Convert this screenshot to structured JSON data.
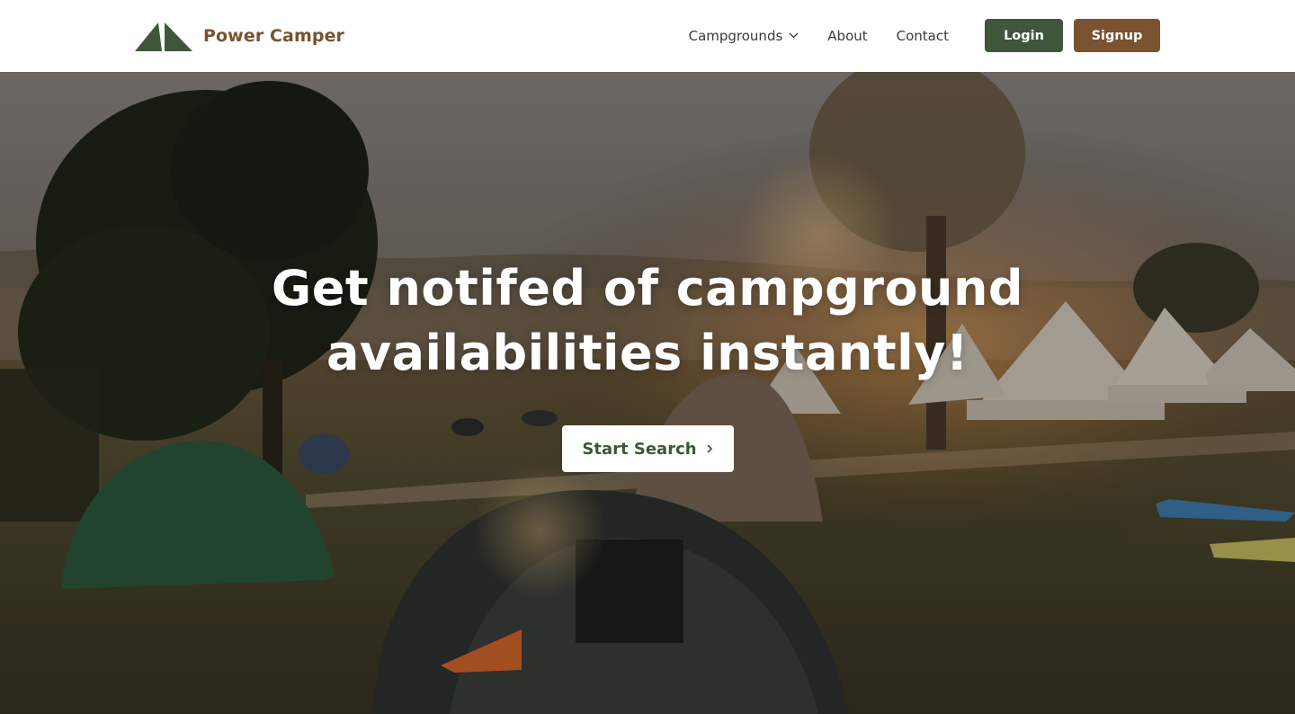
{
  "brand": {
    "name": "Power Camper",
    "logo_icon": "tent-mountain-logo",
    "color": "#7a5230",
    "logo_color": "#3f563b"
  },
  "nav": {
    "items": [
      {
        "label": "Campgrounds",
        "icon": "chevron-down-icon"
      },
      {
        "label": "About"
      },
      {
        "label": "Contact"
      }
    ],
    "login_label": "Login",
    "signup_label": "Signup"
  },
  "colors": {
    "primary_green": "#3f563b",
    "primary_brown": "#7a5230",
    "nav_text": "#3a3a3a"
  },
  "hero": {
    "title": "Get notifed of campground availabilities instantly!",
    "cta_label": "Start Search",
    "cta_icon": "chevron-right-icon",
    "background_image": "campsite-with-tents-at-sunset"
  }
}
